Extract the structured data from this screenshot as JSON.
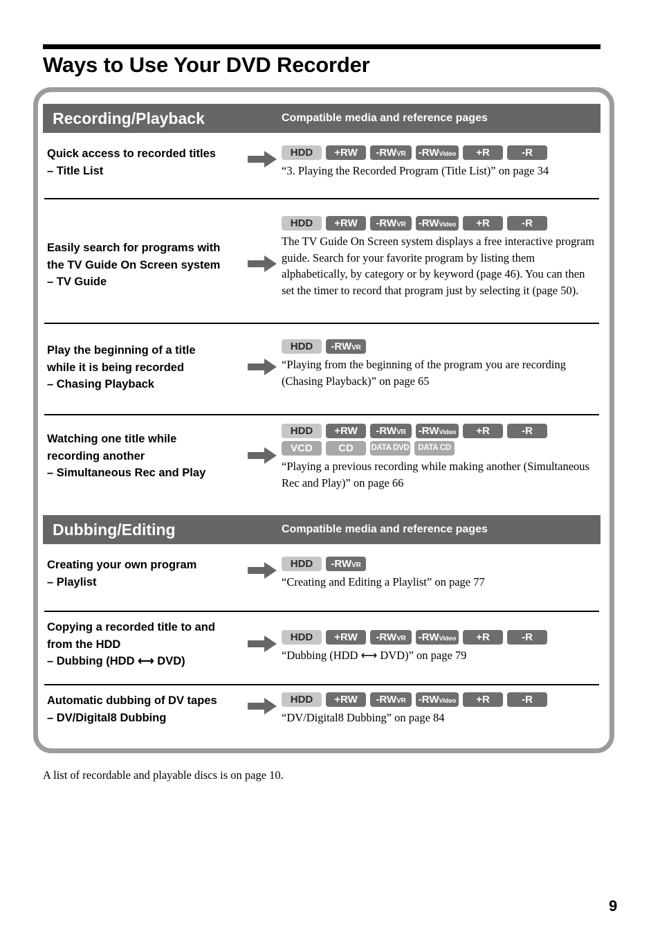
{
  "page": {
    "title": "Ways to Use Your DVD Recorder",
    "footnote": "A list of recordable and playable discs is on page 10.",
    "page_number": "9"
  },
  "colors": {
    "section_bar": "#666666",
    "frame_border": "#9c9c9c",
    "badge_hdd_bg": "#c6c6c6",
    "badge_dark_bg": "#6e6e6e",
    "badge_light_bg": "#a8a8a8",
    "rule": "#000000"
  },
  "sections": [
    {
      "title": "Recording/Playback",
      "subtitle": "Compatible media and reference pages",
      "rows": [
        {
          "heading_line1": "Quick access to recorded titles",
          "heading_line2": "– Title List",
          "badges_row1": [
            "HDD",
            "+RW",
            "-RWVR",
            "-RWVideo",
            "+R",
            "-R"
          ],
          "badges_row2": [],
          "body": "",
          "reference": "“3. Playing the Recorded Program (Title List)” on page 34"
        },
        {
          "heading_line1": "Easily search for programs with",
          "heading_line2": "the TV Guide On Screen system",
          "heading_line3": "– TV Guide",
          "badges_row1": [
            "HDD",
            "+RW",
            "-RWVR",
            "-RWVideo",
            "+R",
            "-R"
          ],
          "badges_row2": [],
          "body": "The TV Guide On Screen system displays a free interactive program guide. Search for your favorite program by listing them alphabetically, by category or by keyword (page 46). You can then set the timer to record that program just by selecting it (page 50).",
          "reference": ""
        },
        {
          "heading_line1": "Play the beginning of a title",
          "heading_line2": "while it is being recorded",
          "heading_line3": "– Chasing Playback",
          "badges_row1": [
            "HDD",
            "-RWVR"
          ],
          "badges_row2": [],
          "body": "",
          "reference": "“Playing from the beginning of the program you are recording (Chasing Playback)” on page 65"
        },
        {
          "heading_line1": "Watching one title while",
          "heading_line2": "recording another",
          "heading_line3": "– Simultaneous Rec and Play",
          "badges_row1": [
            "HDD",
            "+RW",
            "-RWVR",
            "-RWVideo",
            "+R",
            "-R"
          ],
          "badges_row2": [
            "VCD",
            "CD",
            "DATA DVD",
            "DATA CD"
          ],
          "body": "",
          "reference": "“Playing a previous recording while making another (Simultaneous Rec and Play)” on page 66"
        }
      ]
    },
    {
      "title": "Dubbing/Editing",
      "subtitle": "Compatible media and reference pages",
      "rows": [
        {
          "heading_line1": "Creating your own program",
          "heading_line2": "– Playlist",
          "badges_row1": [
            "HDD",
            "-RWVR"
          ],
          "badges_row2": [],
          "body": "",
          "reference": "“Creating and Editing a Playlist” on page 77"
        },
        {
          "heading_line1": "Copying a recorded title to and",
          "heading_line2": "from the HDD",
          "heading_line3": "– Dubbing (HDD ⟷ DVD)",
          "badges_row1": [
            "HDD",
            "+RW",
            "-RWVR",
            "-RWVideo",
            "+R",
            "-R"
          ],
          "badges_row2": [],
          "body": "",
          "reference": "“Dubbing (HDD ⟷ DVD)” on page 79"
        },
        {
          "heading_line1": "Automatic dubbing of DV tapes",
          "heading_line2": "– DV/Digital8 Dubbing",
          "badges_row1": [
            "HDD",
            "+RW",
            "-RWVR",
            "-RWVideo",
            "+R",
            "-R"
          ],
          "badges_row2": [],
          "body": "",
          "reference": "“DV/Digital8 Dubbing” on page 84"
        }
      ]
    }
  ],
  "icons": {
    "arrow": "right-arrow-icon"
  }
}
